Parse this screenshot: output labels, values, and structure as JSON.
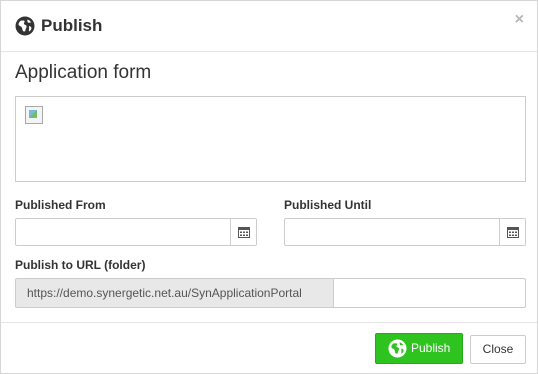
{
  "header": {
    "title": "Publish",
    "icon": "globe-icon",
    "close_label": "×"
  },
  "form": {
    "section_title": "Application form",
    "published_from": {
      "label": "Published From",
      "value": "",
      "icon": "calendar-icon"
    },
    "published_until": {
      "label": "Published Until",
      "value": "",
      "icon": "calendar-icon"
    },
    "publish_url": {
      "label": "Publish to URL (folder)",
      "prefix": "https://demo.synergetic.net.au/SynApplicationPortal",
      "value": ""
    }
  },
  "footer": {
    "publish_label": "Publish",
    "publish_icon": "globe-icon",
    "close_label": "Close"
  },
  "colors": {
    "primary_green": "#2ec31f",
    "text": "#333333",
    "border": "#cccccc",
    "addon_bg": "#e8e8e8"
  }
}
